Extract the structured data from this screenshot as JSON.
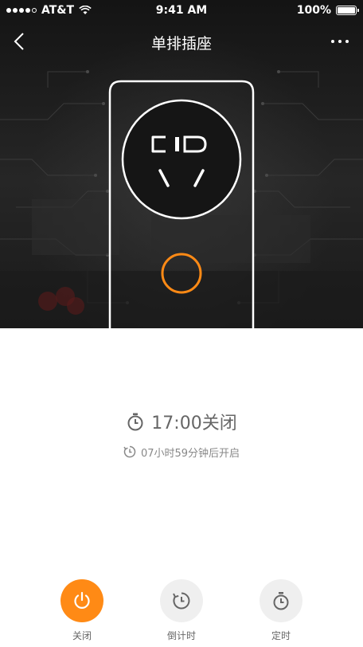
{
  "status_bar": {
    "carrier": "AT&T",
    "time": "9:41 AM",
    "battery": "100%",
    "battery_level": 1.0
  },
  "nav": {
    "title": "单排插座",
    "back_icon": "chevron-left-icon",
    "more_icon": "more-dots-icon"
  },
  "timer": {
    "main_text": "17:00关闭",
    "sub_text": "07小时59分钟后开启"
  },
  "actions": {
    "power_label": "关闭",
    "countdown_label": "倒计时",
    "schedule_label": "定时"
  },
  "colors": {
    "accent": "#ff8a15",
    "hero_bg": "#1e1e1e",
    "text_muted": "#666666"
  }
}
